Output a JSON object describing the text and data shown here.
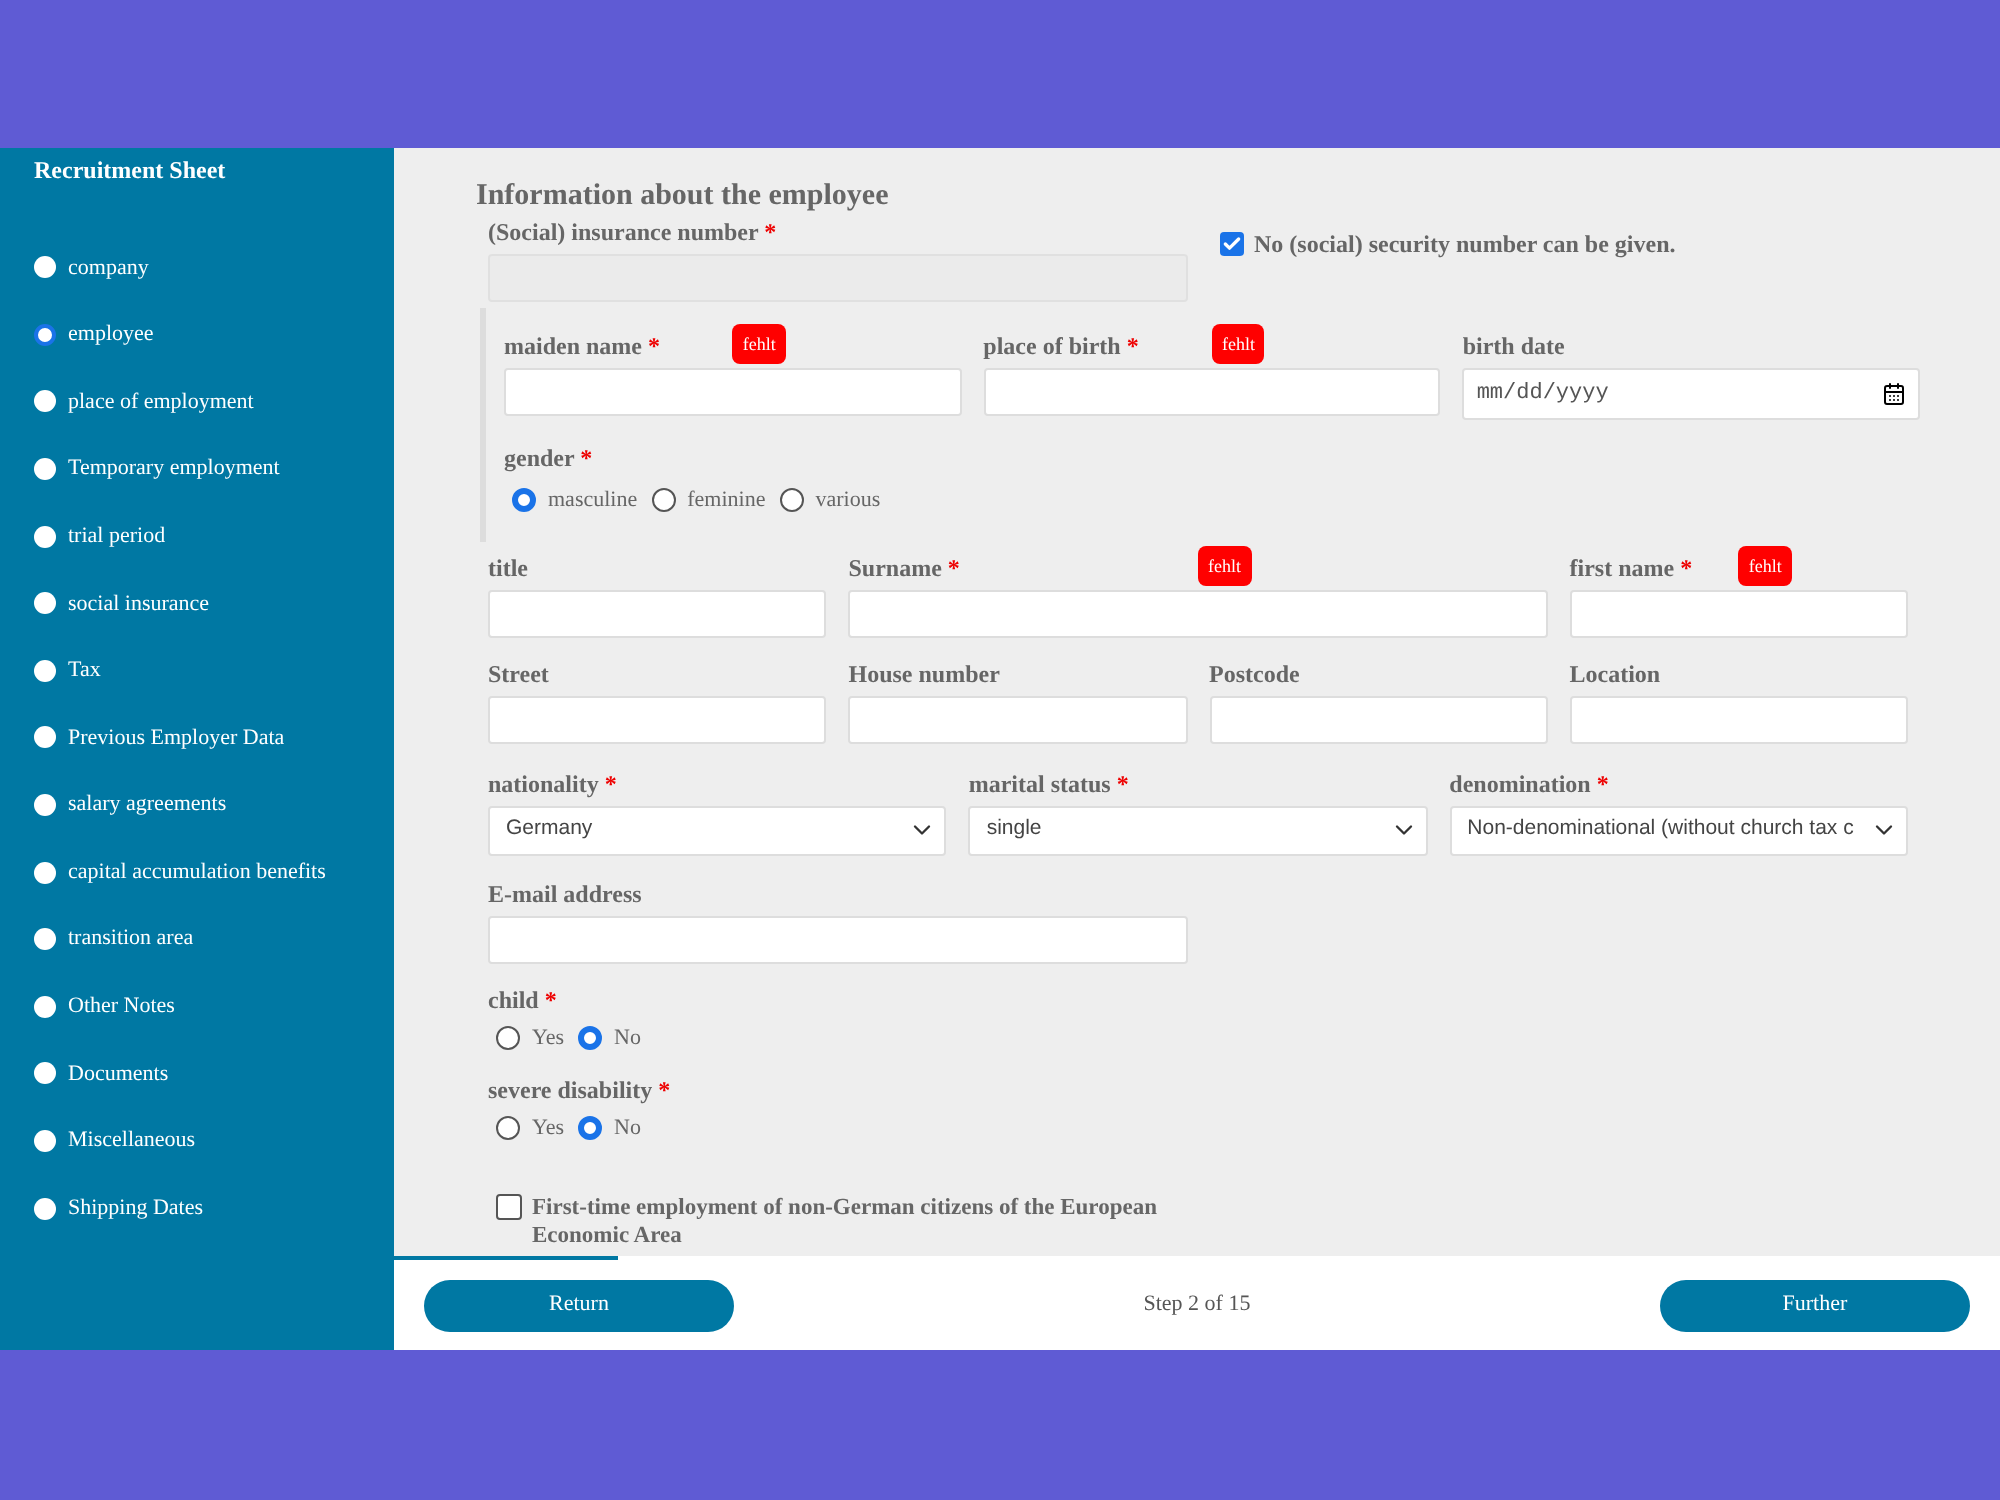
{
  "sidebar": {
    "title": "Recruitment Sheet",
    "items": [
      {
        "label": "company",
        "selected": false
      },
      {
        "label": "employee",
        "selected": true
      },
      {
        "label": "place of employment",
        "selected": false
      },
      {
        "label": "Temporary employment",
        "selected": false
      },
      {
        "label": "trial period",
        "selected": false
      },
      {
        "label": "social insurance",
        "selected": false
      },
      {
        "label": "Tax",
        "selected": false
      },
      {
        "label": "Previous Employer Data",
        "selected": false
      },
      {
        "label": "salary agreements",
        "selected": false
      },
      {
        "label": "capital accumulation benefits",
        "selected": false
      },
      {
        "label": "transition area",
        "selected": false
      },
      {
        "label": "Other Notes",
        "selected": false
      },
      {
        "label": "Documents",
        "selected": false
      },
      {
        "label": "Miscellaneous",
        "selected": false
      },
      {
        "label": "Shipping Dates",
        "selected": false
      }
    ]
  },
  "form": {
    "heading": "Information about the employee",
    "insurance_number": {
      "label": "(Social) insurance number",
      "required": "*",
      "disabled": true
    },
    "no_ssn": {
      "label": "No (social) security number can be given.",
      "checked": true
    },
    "birth_group": {
      "fields": [
        {
          "kind": "text",
          "label": "maiden name",
          "required": "*",
          "badge": "fehlt"
        },
        {
          "kind": "text",
          "label": "place of birth",
          "required": "*",
          "badge": "fehlt"
        },
        {
          "kind": "date",
          "label": "birth date",
          "placeholder": "mm/dd/yyyy"
        }
      ],
      "gender": {
        "label": "gender",
        "required": "*",
        "options": [
          {
            "label": "masculine",
            "selected": true
          },
          {
            "label": "feminine",
            "selected": false
          },
          {
            "label": "various",
            "selected": false
          }
        ]
      }
    },
    "name_row": [
      {
        "kind": "text",
        "label": "title"
      },
      {
        "kind": "text",
        "label": "Surname",
        "required": "*",
        "badge": "fehlt"
      },
      {
        "kind": "text",
        "label": "first name",
        "required": "*",
        "badge": "fehlt"
      }
    ],
    "address_row": [
      {
        "kind": "text",
        "label": "Street"
      },
      {
        "kind": "text",
        "label": "House number"
      },
      {
        "kind": "text",
        "label": "Postcode"
      },
      {
        "kind": "text",
        "label": "Location"
      }
    ],
    "select_row": [
      {
        "kind": "select",
        "label": "nationality",
        "required": "*",
        "value": "Germany"
      },
      {
        "kind": "select",
        "label": "marital status",
        "required": "*",
        "value": "single"
      },
      {
        "kind": "select",
        "label": "denomination",
        "required": "*",
        "value": "Non-denominational (without church tax c"
      }
    ],
    "email": {
      "kind": "text",
      "label": "E-mail address"
    },
    "radio_groups": [
      {
        "label": "child",
        "required": "*",
        "options": [
          {
            "label": "Yes",
            "selected": false
          },
          {
            "label": "No",
            "selected": true
          }
        ]
      },
      {
        "label": "severe disability",
        "required": "*",
        "options": [
          {
            "label": "Yes",
            "selected": false
          },
          {
            "label": "No",
            "selected": true
          }
        ]
      }
    ],
    "eea": {
      "label": "First-time employment of non-German citizens of the European Economic Area",
      "checked": false
    }
  },
  "footer": {
    "progress": {
      "level": 0.14
    },
    "back": "Return",
    "step": "Step 2 of 15",
    "next": "Further"
  }
}
